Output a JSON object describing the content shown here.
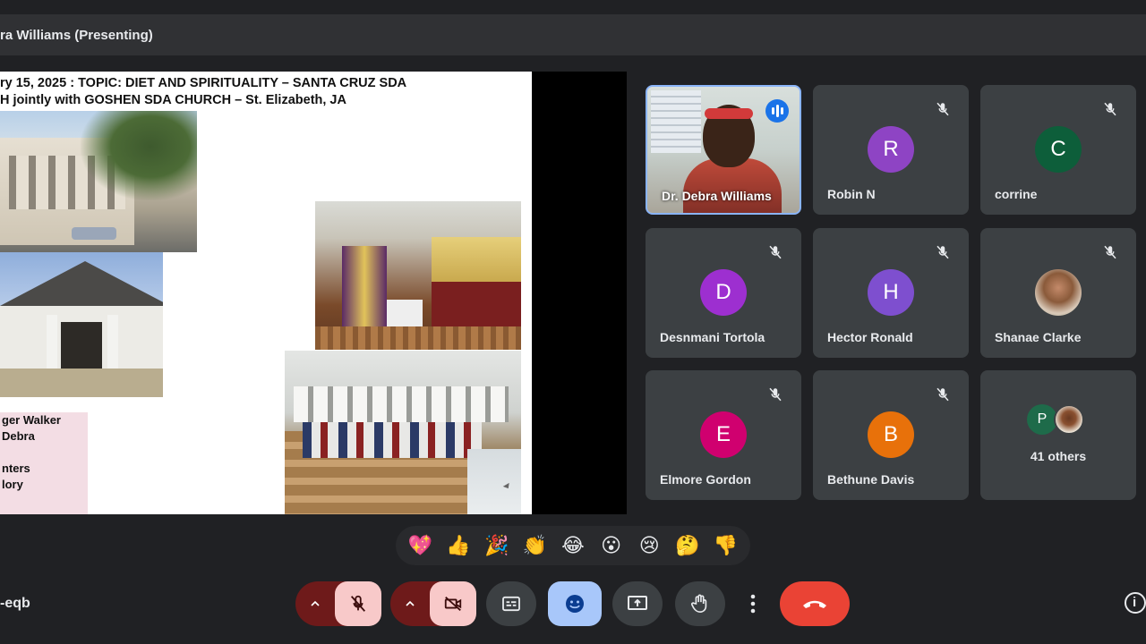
{
  "presenter_bar": {
    "label": "ra Williams (Presenting)"
  },
  "slide": {
    "title_line1": "ry 15, 2025 : TOPIC: DIET AND SPIRITUALITY – SANTA CRUZ SDA",
    "title_line2": "H jointly with GOSHEN SDA CHURCH – St. Elizabeth, JA",
    "pink_lines": [
      "ger Walker",
      "Debra",
      "",
      "nters",
      "lory"
    ]
  },
  "participants": [
    {
      "name": "Dr. Debra Williams",
      "initial": "",
      "color": "",
      "muted": false,
      "speaking": true
    },
    {
      "name": "Robin N",
      "initial": "R",
      "color": "#8e44c4",
      "muted": true
    },
    {
      "name": "corrine",
      "initial": "C",
      "color": "#0d5e3a",
      "muted": true
    },
    {
      "name": "Desnmani Tortola",
      "initial": "D",
      "color": "#9d2fd0",
      "muted": true
    },
    {
      "name": "Hector Ronald",
      "initial": "H",
      "color": "#7e4fcf",
      "muted": true
    },
    {
      "name": "Shanae Clarke",
      "initial": "",
      "color": "",
      "muted": true
    },
    {
      "name": "Elmore Gordon",
      "initial": "E",
      "color": "#d0006f",
      "muted": true
    },
    {
      "name": "Bethune Davis",
      "initial": "B",
      "color": "#e8710a",
      "muted": true
    }
  ],
  "others": {
    "label": "41 others",
    "initial": "P"
  },
  "reactions": [
    "💖",
    "👍",
    "🎉",
    "👏",
    "😂",
    "😮",
    "😢",
    "🤔",
    "👎"
  ],
  "meeting_code": "-eqb"
}
